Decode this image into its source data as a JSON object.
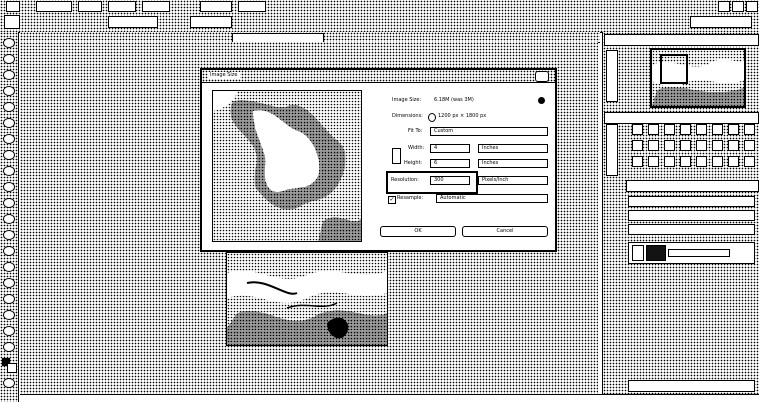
{
  "menubar": {
    "items": [
      "",
      "",
      "",
      "",
      "",
      "",
      ""
    ]
  },
  "dialog": {
    "title": "Image Size",
    "image_size_label": "Image Size:",
    "image_size_value": "6.18M (was 3M)",
    "dimensions_label": "Dimensions:",
    "dimensions_value": "1200 px  ×  1800 px",
    "fit_to_label": "Fit To:",
    "fit_to_value": "Custom",
    "width_label": "Width:",
    "width_value": "4",
    "width_unit": "Inches",
    "height_label": "Height:",
    "height_value": "6",
    "height_unit": "Inches",
    "resolution_label": "Resolution:",
    "resolution_value": "300",
    "resolution_unit": "Pixels/Inch",
    "resample_label": "Resample:",
    "resample_value": "Automatic",
    "ok_label": "OK",
    "cancel_label": "Cancel"
  }
}
